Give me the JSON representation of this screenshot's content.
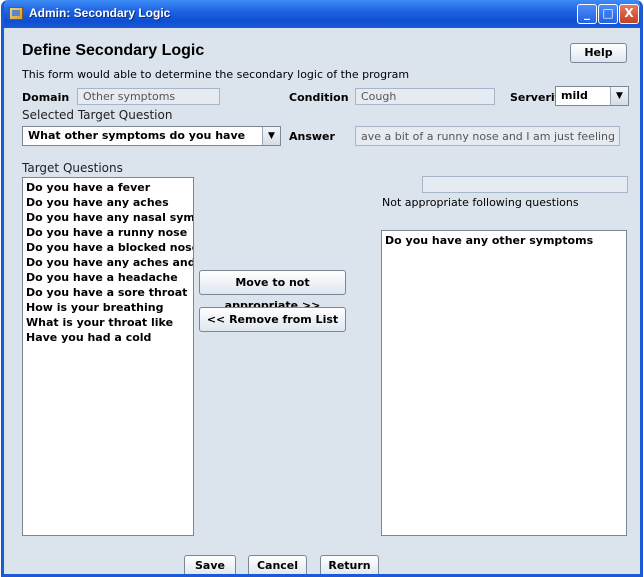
{
  "window": {
    "title": "Admin: Secondary Logic",
    "controls": [
      "_",
      "□",
      "X"
    ]
  },
  "header": {
    "title": "Define Secondary Logic",
    "description": "This form would able to determine the secondary logic of the program",
    "help_label": "Help"
  },
  "fields": {
    "domain_label": "Domain",
    "domain_value": "Other symptoms",
    "condition_label": "Condition",
    "condition_value": "Cough",
    "severity_label": "Serverity",
    "severity_value": "mild",
    "selected_target_label": "Selected Target Question",
    "selected_target_value": "What other symptoms do you have",
    "answer_label": "Answer",
    "answer_value": "ave a bit of a runny nose and I am just feeling a bit run down"
  },
  "target_questions": {
    "label": "Target Questions",
    "items": [
      "Do you have a fever",
      "Do you have any aches",
      "Do you have any nasal symptoms",
      "Do you have a runny nose",
      "Do you have a blocked nose",
      "Do you have any aches and pains",
      "Do you have a headache",
      "Do you have a sore throat",
      "How is your breathing",
      "What is your throat like",
      "Have you had a cold"
    ]
  },
  "actions": {
    "move_label": "Move to not appropriate >>",
    "remove_label": "<< Remove from List"
  },
  "not_appropriate": {
    "label": "Not appropriate following questions",
    "items": [
      "Do you have any other symptoms"
    ]
  },
  "footer": {
    "save_label": "Save",
    "cancel_label": "Cancel",
    "return_label": "Return"
  }
}
